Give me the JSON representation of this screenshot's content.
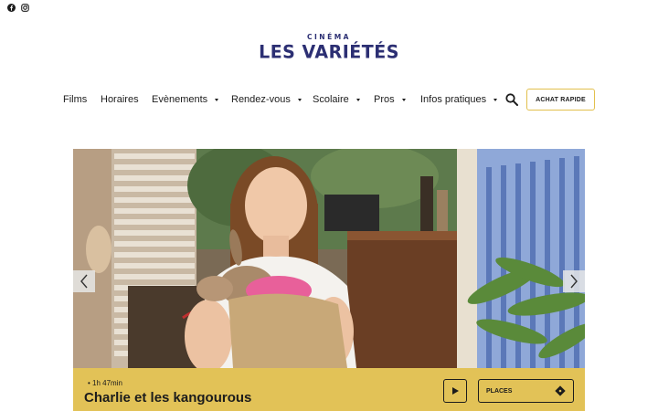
{
  "social": {
    "facebook_icon": "facebook-icon",
    "instagram_icon": "instagram-icon"
  },
  "logo": {
    "top_text": "CINÉMA",
    "main_text": "LES VARIÉTÉS",
    "color": "#2c2f73"
  },
  "nav": {
    "items": [
      {
        "label": "Films",
        "has_dropdown": false
      },
      {
        "label": "Horaires",
        "has_dropdown": false
      },
      {
        "label": "Evènements",
        "has_dropdown": true
      },
      {
        "label": "Rendez-vous",
        "has_dropdown": true
      },
      {
        "label": "Scolaire",
        "has_dropdown": true
      },
      {
        "label": "Pros",
        "has_dropdown": true
      },
      {
        "label": "Infos pratiques",
        "has_dropdown": true
      }
    ],
    "search_icon": "search-icon",
    "buy_label": "ACHAT RAPIDE"
  },
  "slider": {
    "prev_icon": "chevron-left-icon",
    "next_icon": "chevron-right-icon",
    "image": "girl-holding-baby-kangaroo"
  },
  "featured": {
    "duration": "1h 47min",
    "title": "Charlie et les kangourous",
    "play_icon": "play-icon",
    "places_label": "PLACES",
    "ticket_icon": "ticket-icon"
  },
  "colors": {
    "accent": "#e2c257",
    "brand": "#2c2f73",
    "button_border": "#e2c04d"
  }
}
